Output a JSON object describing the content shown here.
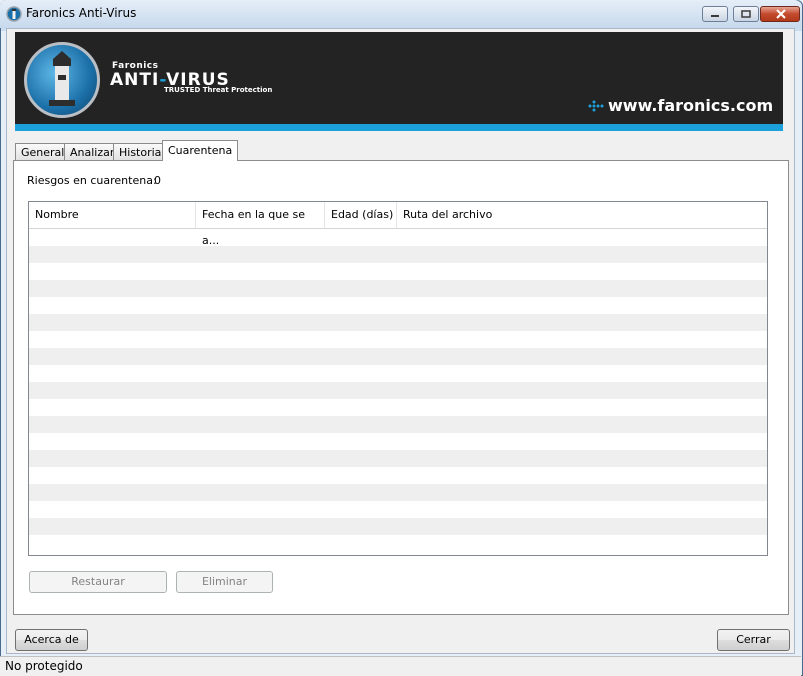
{
  "window": {
    "title": "Faronics Anti-Virus",
    "controls": [
      "minimize-icon",
      "maximize-icon",
      "close-icon"
    ]
  },
  "banner": {
    "brand_small": "Faronics",
    "product_prefix": "ANTI",
    "product_dash": "-",
    "product_suffix": "VIRUS",
    "tagline": "TRUSTED Threat Protection",
    "website": "www.faronics.com",
    "accent_color": "#1ba0db",
    "background_color": "#232323"
  },
  "tabs": [
    {
      "label": "General"
    },
    {
      "label": "Analizar"
    },
    {
      "label": "Historial"
    },
    {
      "label": "Cuarentena",
      "active": true
    }
  ],
  "quarantine": {
    "risks_label": "Riesgos en cuarentena:",
    "risks_count": "0",
    "columns": [
      "Nombre",
      "Fecha en la que se a...",
      "Edad (días)",
      "Ruta del archivo"
    ],
    "rows": []
  },
  "buttons": {
    "restore": "Restaurar",
    "delete": "Eliminar",
    "about": "Acerca de",
    "close": "Cerrar"
  },
  "status": {
    "text": "No protegido"
  }
}
